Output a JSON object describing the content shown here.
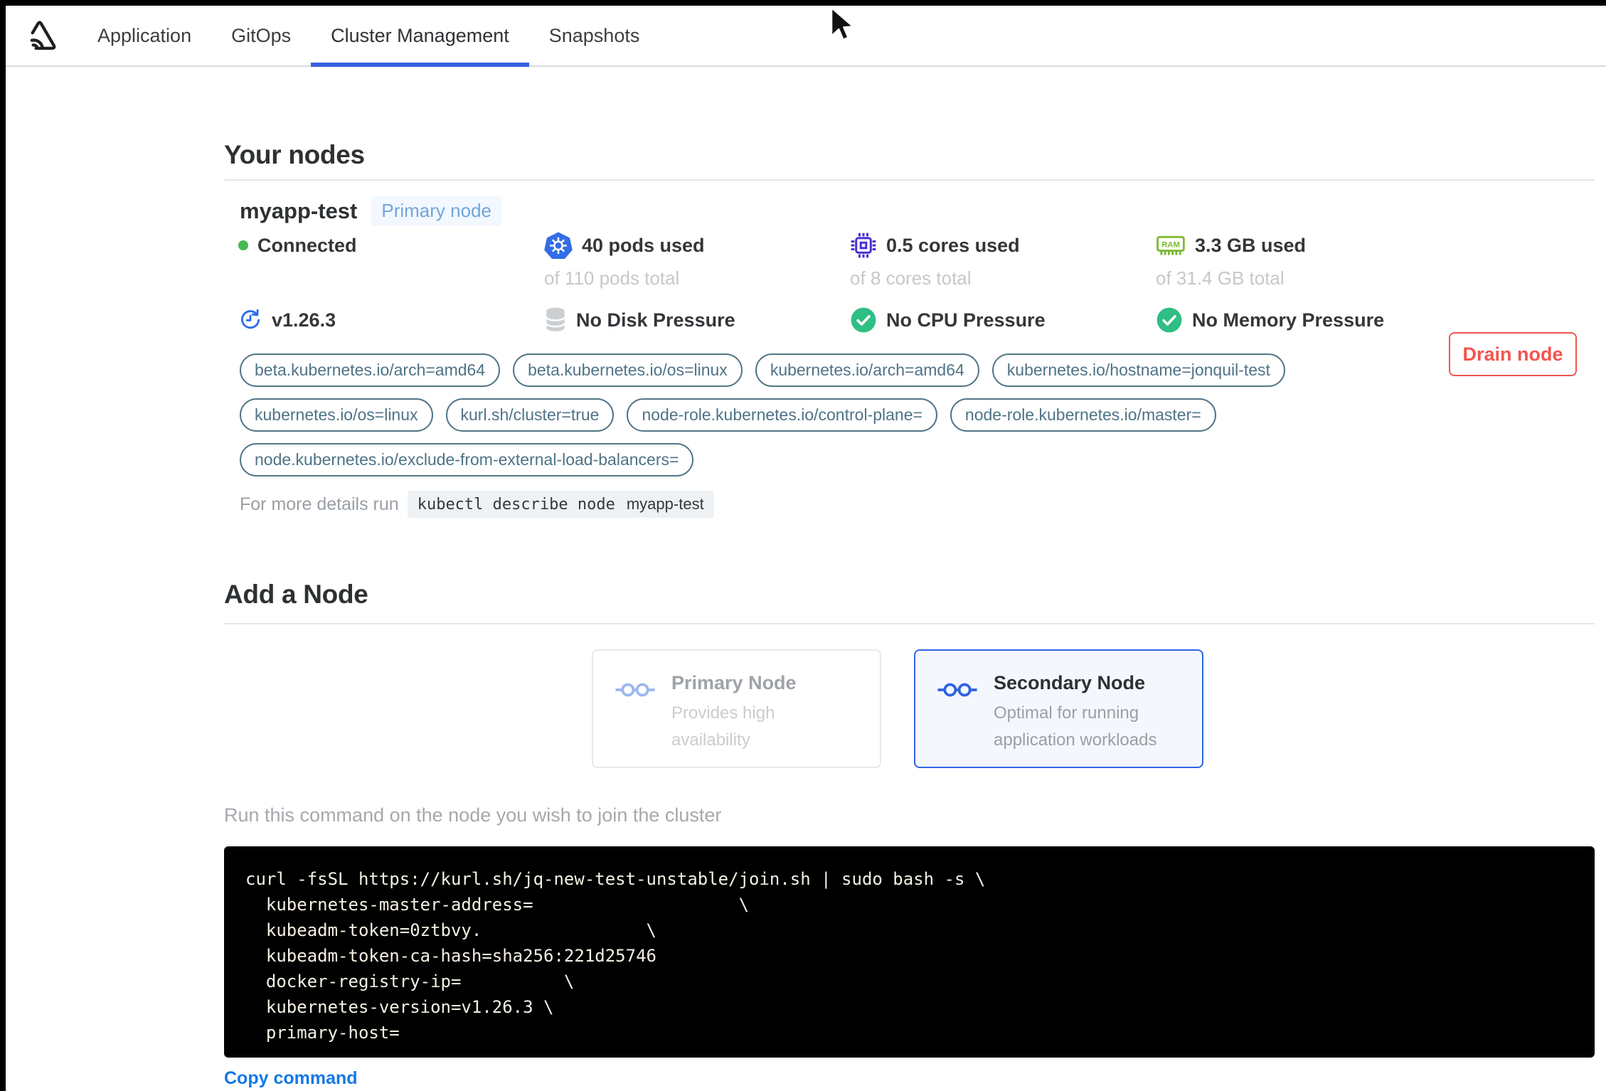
{
  "header": {
    "tabs": [
      {
        "label": "Application"
      },
      {
        "label": "GitOps"
      },
      {
        "label": "Cluster Management"
      },
      {
        "label": "Snapshots"
      }
    ]
  },
  "your_nodes": {
    "title": "Your nodes",
    "node": {
      "name": "myapp-test",
      "badge": "Primary node",
      "status": "Connected",
      "version": "v1.26.3",
      "pods_used": "40 pods used",
      "pods_total": "of 110 pods total",
      "cores_used": "0.5 cores used",
      "cores_total": "of 8 cores total",
      "memory_used": "3.3 GB used",
      "memory_total": "of 31.4 GB total",
      "disk_pressure": "No Disk Pressure",
      "cpu_pressure": "No CPU Pressure",
      "memory_pressure": "No Memory Pressure",
      "labels": [
        "beta.kubernetes.io/arch=amd64",
        "beta.kubernetes.io/os=linux",
        "kubernetes.io/arch=amd64",
        "kubernetes.io/hostname=jonquil-test",
        "kubernetes.io/os=linux",
        "kurl.sh/cluster=true",
        "node-role.kubernetes.io/control-plane=",
        "node-role.kubernetes.io/master=",
        "node.kubernetes.io/exclude-from-external-load-balancers="
      ],
      "details_prefix": "For more details run",
      "details_command": "kubectl describe node",
      "details_node": "myapp-test",
      "drain_button": "Drain node"
    }
  },
  "add_node": {
    "title": "Add a Node",
    "cards": [
      {
        "title": "Primary Node",
        "line1": "Provides high",
        "line2": "availability"
      },
      {
        "title": "Secondary Node",
        "line1": "Optimal for running",
        "line2": "application workloads"
      }
    ],
    "instruction": "Run this command on the node you wish to join the cluster",
    "command_lines": [
      "curl -fsSL https://kurl.sh/jq-new-test-unstable/join.sh | sudo bash -s \\",
      "  kubernetes-master-address=                    \\",
      "  kubeadm-token=0ztbvy.                \\",
      "  kubeadm-token-ca-hash=sha256:221d25746",
      "  docker-registry-ip=          \\",
      "  kubernetes-version=v1.26.3 \\",
      "  primary-host="
    ],
    "copy_label": "Copy command"
  },
  "colors": {
    "accent_blue": "#3661e0",
    "badge_blue": "#72a5db",
    "kubernetes_blue": "#326de5",
    "cpu_indigo": "#4b2fd0",
    "ram_green": "#7cb82f",
    "check_green": "#2fbe84",
    "connected_green": "#44b954",
    "pill_slate": "#527586",
    "drain_red": "#f2554f",
    "link_blue": "#1577e8",
    "code_bg": "#000000",
    "code_text": "#f4f0e3"
  }
}
